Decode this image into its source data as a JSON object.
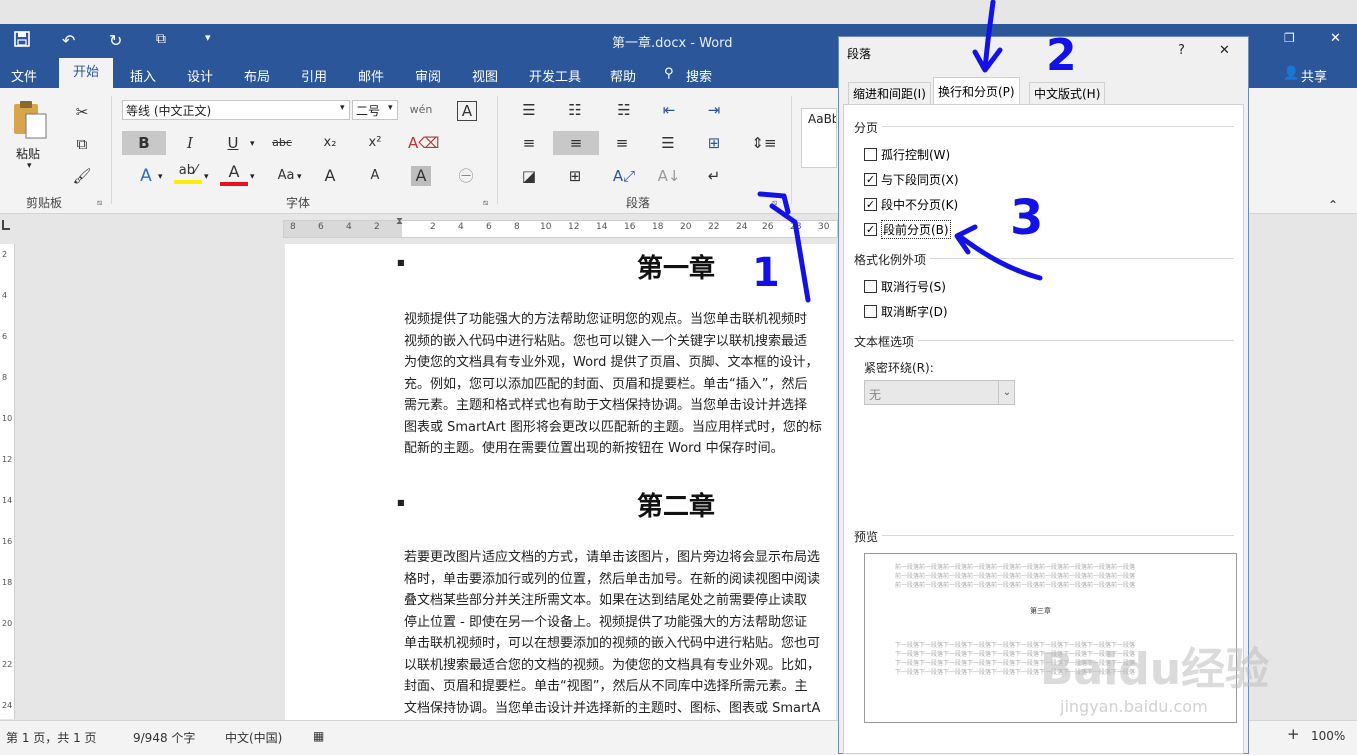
{
  "window": {
    "title": "第一章.docx - Word"
  },
  "ribbon_tabs": [
    "文件",
    "开始",
    "插入",
    "设计",
    "布局",
    "引用",
    "邮件",
    "审阅",
    "视图",
    "开发工具",
    "帮助"
  ],
  "search_label": "搜索",
  "share_label": "共享",
  "ribbon": {
    "paste_label": "粘贴",
    "font_name": "等线 (中文正文)",
    "font_size": "二号",
    "groups": {
      "clipboard": "剪贴板",
      "font": "字体",
      "paragraph": "段落"
    },
    "styles_preview": "AaBb",
    "buttons": {
      "bold": "B",
      "italic": "I",
      "underline": "U",
      "strike": "abc",
      "sub": "x₂",
      "sup": "x²",
      "wen": "wén",
      "charbox": "A",
      "textfx": "A",
      "fontcolor": "A",
      "case": "Aa",
      "grow": "A",
      "shrink": "A",
      "shade": "A",
      "enclose": "㊀"
    }
  },
  "ruler_numbers": [
    "8",
    "6",
    "4",
    "2",
    "2",
    "4",
    "6",
    "8",
    "10",
    "12",
    "14",
    "16",
    "18",
    "20",
    "22",
    "24",
    "26",
    "28",
    "30"
  ],
  "vruler_numbers": [
    "2",
    "4",
    "6",
    "8",
    "10",
    "12",
    "14",
    "16",
    "18",
    "20",
    "22",
    "24"
  ],
  "document": {
    "heading1": "第一章",
    "para1": [
      "视频提供了功能强大的方法帮助您证明您的观点。当您单击联机视频时",
      "视频的嵌入代码中进行粘贴。您也可以键入一个关键字以联机搜索最适",
      "为使您的文档具有专业外观，Word 提供了页眉、页脚、文本框的设计，",
      "充。例如，您可以添加匹配的封面、页眉和提要栏。单击“插入”，然后",
      "需元素。主题和格式样式也有助于文档保持协调。当您单击设计并选择",
      "图表或 SmartArt 图形将会更改以匹配新的主题。当应用样式时，您的标",
      "配新的主题。使用在需要位置出现的新按钮在 Word 中保存时间。"
    ],
    "heading2": "第二章",
    "para2": [
      "若要更改图片适应文档的方式，请单击该图片，图片旁边将会显示布局选",
      "格时，单击要添加行或列的位置，然后单击加号。在新的阅读视图中阅读",
      "叠文档某些部分并关注所需文本。如果在达到结尾处之前需要停止读取",
      "停止位置 - 即使在另一个设备上。视频提供了功能强大的方法帮助您证",
      "单击联机视频时，可以在想要添加的视频的嵌入代码中进行粘贴。您也可",
      "以联机搜索最适合您的文档的视频。为使您的文档具有专业外观。比如，",
      "封面、页眉和提要栏。单击“视图”，然后从不同库中选择所需元素。主",
      "文档保持协调。当您单击设计并选择新的主题时、图标、图表或 SmartA"
    ]
  },
  "status": {
    "page": "第 1 页，共 1 页",
    "words": "9/948 个字",
    "lang": "中文(中国)",
    "zoom": "100%"
  },
  "dialog": {
    "title": "段落",
    "help": "?",
    "close": "✕",
    "tabs": [
      "缩进和间距(I)",
      "换行和分页(P)",
      "中文版式(H)"
    ],
    "sections": {
      "pagination": "分页",
      "exceptions": "格式化例外项",
      "textbox": "文本框选项",
      "preview": "预览"
    },
    "options": [
      {
        "label": "孤行控制(W)",
        "checked": false
      },
      {
        "label": "与下段同页(X)",
        "checked": true
      },
      {
        "label": "段中不分页(K)",
        "checked": true
      },
      {
        "label": "段前分页(B)",
        "checked": true
      }
    ],
    "exceptions": [
      {
        "label": "取消行号(S)",
        "checked": false
      },
      {
        "label": "取消断字(D)",
        "checked": false
      }
    ],
    "tight_wrap_label": "紧密环绕(R):",
    "tight_wrap_value": "无",
    "preview_heading": "第三章",
    "preview_before": "前一段落前一段落前一段落前一段落前一段落前一段落前一段落前一段落前一段落前一段落",
    "preview_after": "下一段落下一段落下一段落下一段落下一段落下一段落下一段落下一段落下一段落下一段落"
  },
  "annotations": {
    "n1": "1",
    "n2": "2",
    "n3": "3"
  },
  "watermark": {
    "brand": "Baidu经验",
    "url": "jingyan.baidu.com"
  },
  "colors": {
    "word_blue": "#2b579a",
    "annotation": "#1212e8"
  }
}
